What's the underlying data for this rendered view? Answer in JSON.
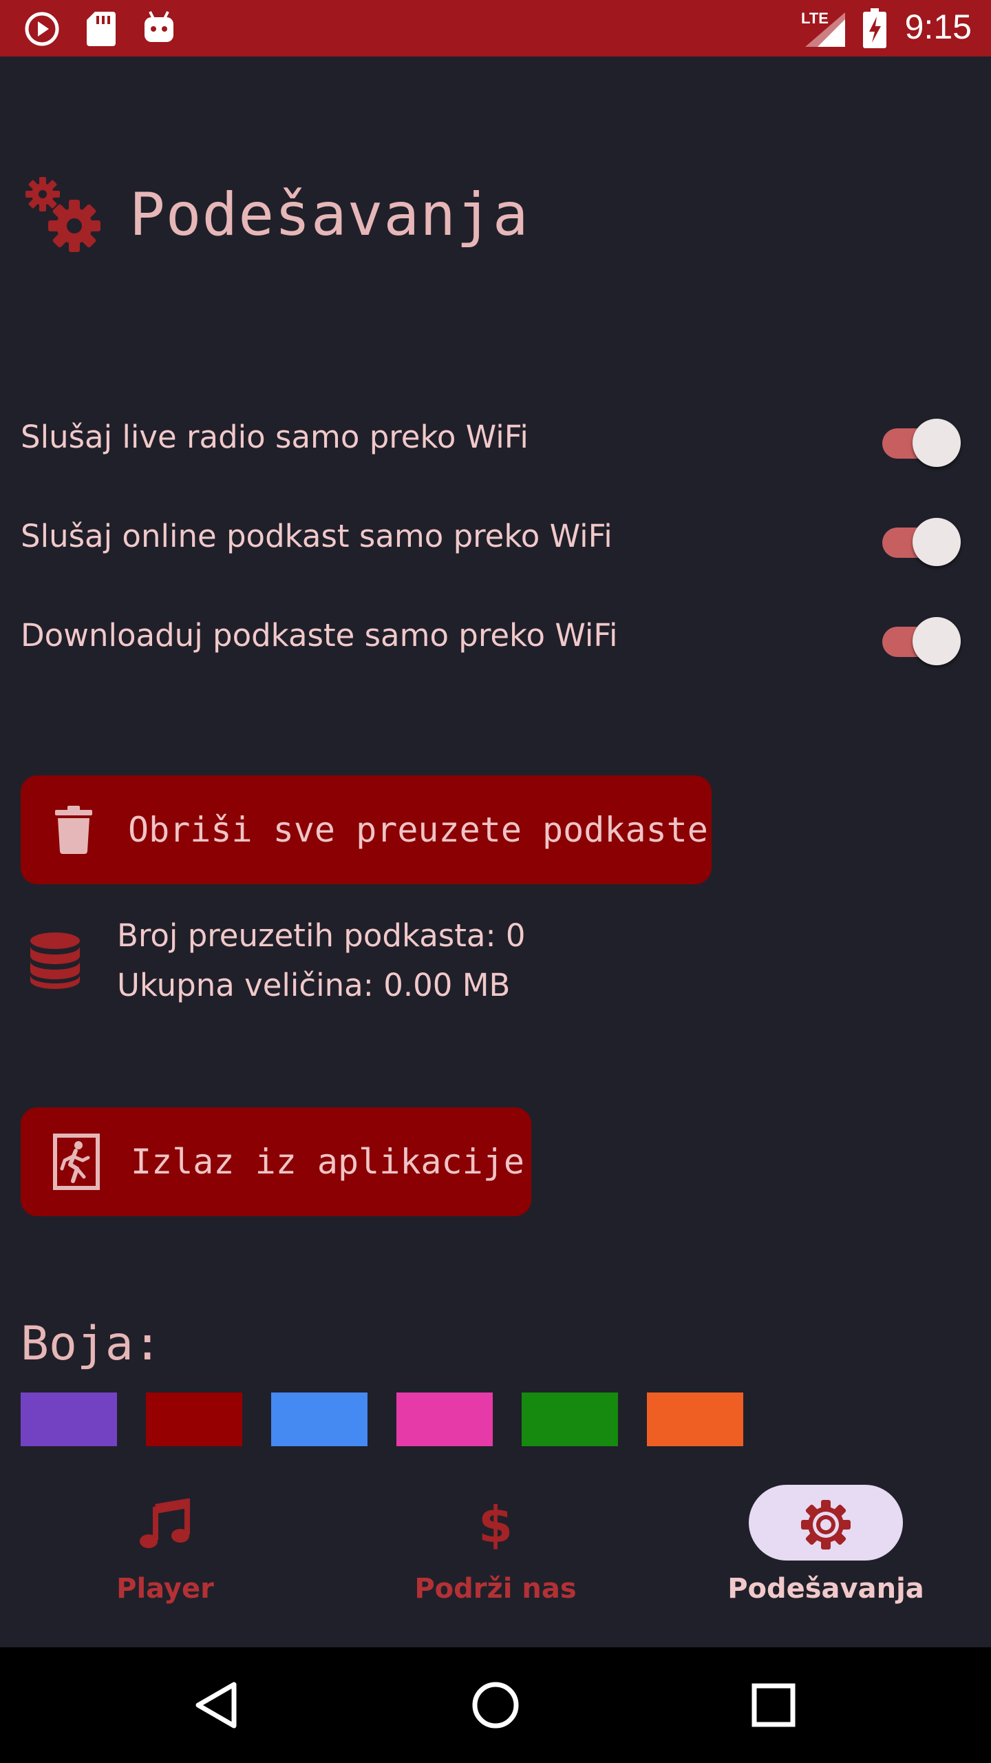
{
  "status_bar": {
    "time": "9:15",
    "network": "LTE",
    "icons": [
      "play-circle-icon",
      "sd-card-icon",
      "android-icon",
      "signal-icon",
      "battery-charging-icon"
    ]
  },
  "header": {
    "title": "Podešavanja",
    "icon": "gears-icon"
  },
  "toggles": [
    {
      "label": "Slušaj live radio samo preko WiFi",
      "on": true
    },
    {
      "label": "Slušaj online podkast samo preko WiFi",
      "on": true
    },
    {
      "label": "Downloaduj podkaste samo preko WiFi",
      "on": true
    }
  ],
  "delete_button": {
    "label": "Obriši sve preuzete podkaste",
    "icon": "trash-icon"
  },
  "storage": {
    "icon": "database-icon",
    "count_line": "Broj preuzetih podkasta: 0",
    "size_line": "Ukupna veličina: 0.00 MB"
  },
  "exit_button": {
    "label": "Izlaz iz aplikacije",
    "icon": "exit-door-icon"
  },
  "colors": {
    "label": "Boja:",
    "swatches": [
      "#7342c2",
      "#960000",
      "#4589f2",
      "#e63aa8",
      "#16890f",
      "#ef5f24"
    ]
  },
  "bottom_nav": {
    "items": [
      {
        "label": "Player",
        "icon": "music-note-icon",
        "active": false
      },
      {
        "label": "Podrži nas",
        "icon": "dollar-icon",
        "active": false
      },
      {
        "label": "Podešavanja",
        "icon": "gear-icon",
        "active": true
      }
    ]
  },
  "theme": {
    "accent": "#a0171d",
    "background": "#20202a",
    "button": "#8a0003",
    "text": "#f1c9ca"
  },
  "system_nav": [
    "back-icon",
    "home-icon",
    "recents-icon"
  ]
}
